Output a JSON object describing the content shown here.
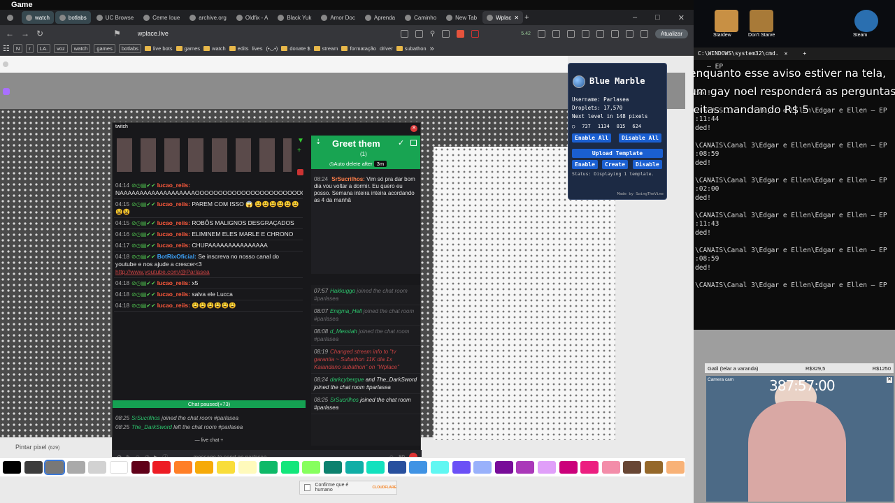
{
  "window": {
    "title": "Game"
  },
  "tabs": [
    {
      "label": "",
      "style": "plain"
    },
    {
      "label": "watch",
      "style": "pill"
    },
    {
      "label": "botlabs",
      "style": "pill"
    },
    {
      "label": "UC Browse",
      "style": "plain"
    },
    {
      "label": "Ceme Ioue",
      "style": "plain"
    },
    {
      "label": "archive.org",
      "style": "plain"
    },
    {
      "label": "Oldfix - A",
      "style": "plain"
    },
    {
      "label": "Black Yuk",
      "style": "plain"
    },
    {
      "label": "Amor Doc",
      "style": "plain"
    },
    {
      "label": "Aprenda",
      "style": "plain"
    },
    {
      "label": "Caminho",
      "style": "plain"
    },
    {
      "label": "New Tab",
      "style": "plain"
    },
    {
      "label": "Wplac",
      "style": "active"
    }
  ],
  "address": {
    "url": "wplace.live",
    "update_label": "Atualizar",
    "ext_counter": "5.42"
  },
  "bookmarks": [
    {
      "label": "N",
      "box": true
    },
    {
      "label": "r",
      "box": true
    },
    {
      "label": "LA.",
      "box": true
    },
    {
      "label": "voz",
      "box": true
    },
    {
      "label": "watch",
      "box": true
    },
    {
      "label": "games",
      "box": true
    },
    {
      "label": "botlabs",
      "box": true
    },
    {
      "label": "live bots",
      "folder": true
    },
    {
      "label": "games",
      "folder": true
    },
    {
      "label": "watch",
      "folder": true
    },
    {
      "label": "edits",
      "folder": true
    },
    {
      "label": "lives",
      "folder": false
    },
    {
      "label": "(•◡•)",
      "folder": false
    },
    {
      "label": "donate $",
      "folder": true
    },
    {
      "label": "stream",
      "folder": true
    },
    {
      "label": "formatação",
      "folder": true
    },
    {
      "label": "driver",
      "folder": false
    },
    {
      "label": "subathon",
      "folder": true
    }
  ],
  "twitch": {
    "title": "twitch",
    "messages": [
      {
        "time": "04:14",
        "user": "lucao_reiis:",
        "text": "NAAAAAAAAAAAAAAAAAAAOOOOOOOOOOOOOOOOOOOOOOOO"
      },
      {
        "time": "04:15",
        "user": "lucao_reiis:",
        "text": "PAREM COM ISSO 😱 😫😫😫😫😫😫😫😫"
      },
      {
        "time": "04:15",
        "user": "lucao_reiis:",
        "text": "ROBÔS MALIGNOS DESGRAÇADOS"
      },
      {
        "time": "04:16",
        "user": "lucao_reiis:",
        "text": "ELIMINEM ELES MARLE E CHRONO"
      },
      {
        "time": "04:17",
        "user": "lucao_reiis:",
        "text": "CHUPAAAAAAAAAAAAAAA"
      },
      {
        "time": "04:18",
        "user": "BotRixOficial:",
        "text": "Se inscreva no nosso canal do youtube e nos ajude a crescer<3",
        "link": "http://www.youtube.com/@Parlasea"
      },
      {
        "time": "04:18",
        "user": "lucao_reiis:",
        "text": "x5"
      },
      {
        "time": "04:18",
        "user": "lucao_reiis:",
        "text": "salva ele Lucca"
      },
      {
        "time": "04:18",
        "user": "lucao_reiis:",
        "text": "😫😫😫😫😫😫"
      }
    ],
    "paused": "Chat paused(+73)",
    "joins": [
      {
        "time": "08:25",
        "user": "SrSucrilhos",
        "action": "joined the chat room #parlasea"
      },
      {
        "time": "08:25",
        "user": "The_DarkSword",
        "action": "left the chat room #parlasea"
      }
    ],
    "live_chat": "live chat",
    "input_placeholder": "message to send on parlasea...",
    "viewer_count": "80"
  },
  "greet": {
    "title": "Greet them",
    "count": "(1)",
    "auto_delete": "Auto delete after",
    "auto_delete_value": "3m",
    "msg_time": "08:24",
    "msg_user": "SrSucrilhos:",
    "msg_text": "Vim só pra dar bom dia vou voltar a dormir. Eu quero eu posso. Semana inteira inteira acordando as 4 da manhã",
    "history": [
      {
        "time": "07:57",
        "user": "Hakkuggo",
        "text": "joined the chat room #parlasea",
        "dim": true
      },
      {
        "time": "08:07",
        "user": "Enigma_Hell",
        "text": "joined the chat room #parlasea",
        "dim": true
      },
      {
        "time": "08:08",
        "user": "d_Messiah",
        "text": "joined the chat room #parlasea",
        "dim": true
      },
      {
        "time": "08:19",
        "user": "",
        "text": "Changed stream info to \"tv garantia ~ Subathon 11K dia 1x Kaiandano subathon\" on \"Wplace\"",
        "dim": true,
        "red": true
      },
      {
        "time": "08:24",
        "user": "darkcybergue",
        "text": "and The_DarkSword joined the chat room #parlasea",
        "dim": false
      },
      {
        "time": "08:25",
        "user": "SrSucrilhos",
        "text": "joined the chat room #parlasea",
        "dim": false
      }
    ]
  },
  "bluemarble": {
    "title": "Blue Marble",
    "username": "Username: Parlasea",
    "droplets": "Droplets: 17,570",
    "next_level": "Next level in 148 pixels",
    "coords": [
      "737",
      "1134",
      "815",
      "624"
    ],
    "enable_all": "Enable All",
    "disable_all": "Disable All",
    "upload": "Upload Template",
    "enable": "Enable",
    "create": "Create",
    "disable": "Disable",
    "status": "Status: Displaying 1 template.",
    "footer": "Made by SwingTheVine"
  },
  "paint": {
    "label": "Pintar pixel",
    "count": "(629)"
  },
  "captcha": {
    "label": "Confirme que é humano",
    "brand": "CLOUDFLARE"
  },
  "palette": [
    "#000000",
    "#3c3c3c",
    "#787878",
    "#aaaaaa",
    "#d2d2d2",
    "#ffffff",
    "#600018",
    "#ed1c24",
    "#ff7f27",
    "#f6aa09",
    "#f9dd3b",
    "#fffabc",
    "#0eb968",
    "#13e67b",
    "#87ff5e",
    "#0c816e",
    "#10aea6",
    "#13e1be",
    "#28509e",
    "#4093e4",
    "#60f7f2",
    "#6b50f6",
    "#99b1fb",
    "#780c99",
    "#aa38b9",
    "#e09ff9",
    "#cb007a",
    "#ec1f80",
    "#f38da9",
    "#684634",
    "#95682a",
    "#f8b277"
  ],
  "desktop": {
    "icons": [
      {
        "label": "Stardew"
      },
      {
        "label": "Don't Starve"
      },
      {
        "label": "Steam"
      }
    ]
  },
  "cmd": {
    "tab": "C:\\WINDOWS\\system32\\cmd.",
    "overlay": "enquanto esse aviso estiver na tela, um gay noel responderá as perguntas feitas mandando R$ 5",
    "lines": [
      "   — EP",
      "",
      "",
      "ded!",
      "",
      "\\CANAIS\\Canal 3\\Edgar e Ellen\\Edgar e Ellen — EP",
      ":11:44",
      "ded!",
      "",
      "\\CANAIS\\Canal 3\\Edgar e Ellen\\Edgar e Ellen — EP",
      ":08:59",
      "ded!",
      "",
      "\\CANAIS\\Canal 3\\Edgar e Ellen\\Edgar e Ellen — EP",
      ":02:00",
      "ded!",
      "",
      "\\CANAIS\\Canal 3\\Edgar e Ellen\\Edgar e Ellen — EP",
      ":11:43",
      "ded!",
      "",
      "\\CANAIS\\Canal 3\\Edgar e Ellen\\Edgar e Ellen — EP",
      ":08:59",
      "ded!",
      "",
      "\\CANAIS\\Canal 3\\Edgar e Ellen\\Edgar e Ellen — EP"
    ]
  },
  "donation": {
    "label": "Gatil (telar a varanda)",
    "amount": "R$329,5",
    "goal": "R$1250"
  },
  "cam": {
    "timer": "387:57:00",
    "label": "Camera cam"
  }
}
